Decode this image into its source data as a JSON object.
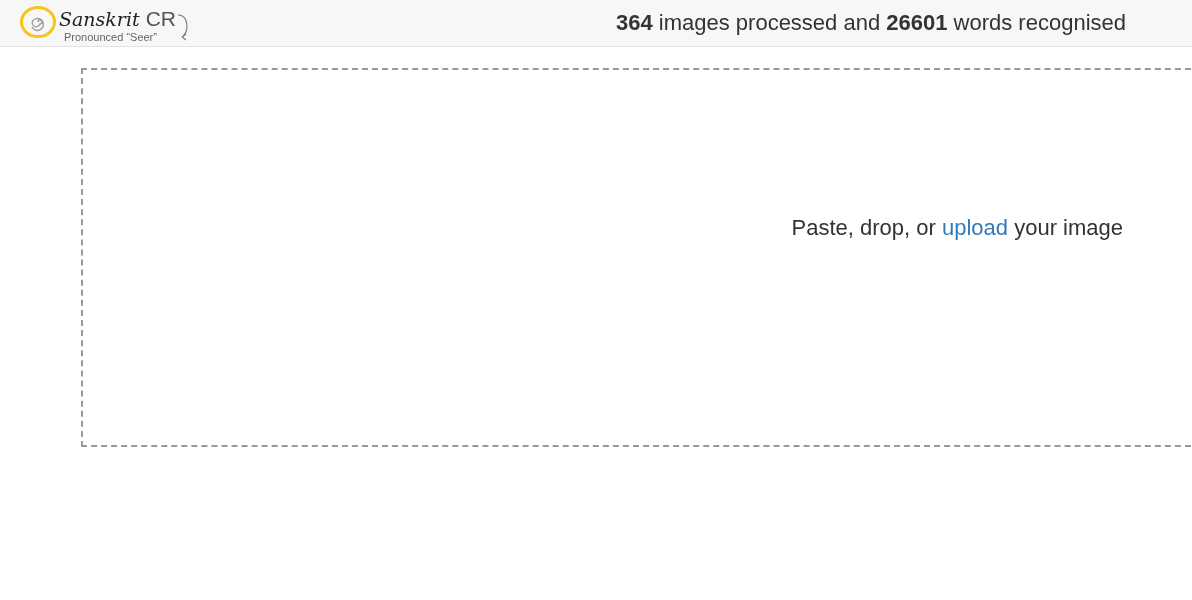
{
  "header": {
    "logo": {
      "name_script": "Sanskrit",
      "name_suffix": "CR",
      "tagline": "Pronounced “Seer”"
    },
    "stats": "**364** images processed and **26601** words recognised"
  },
  "dropzone": {
    "text_before": "Paste, drop, or",
    "link": "upload",
    "text_after": "your image"
  }
}
